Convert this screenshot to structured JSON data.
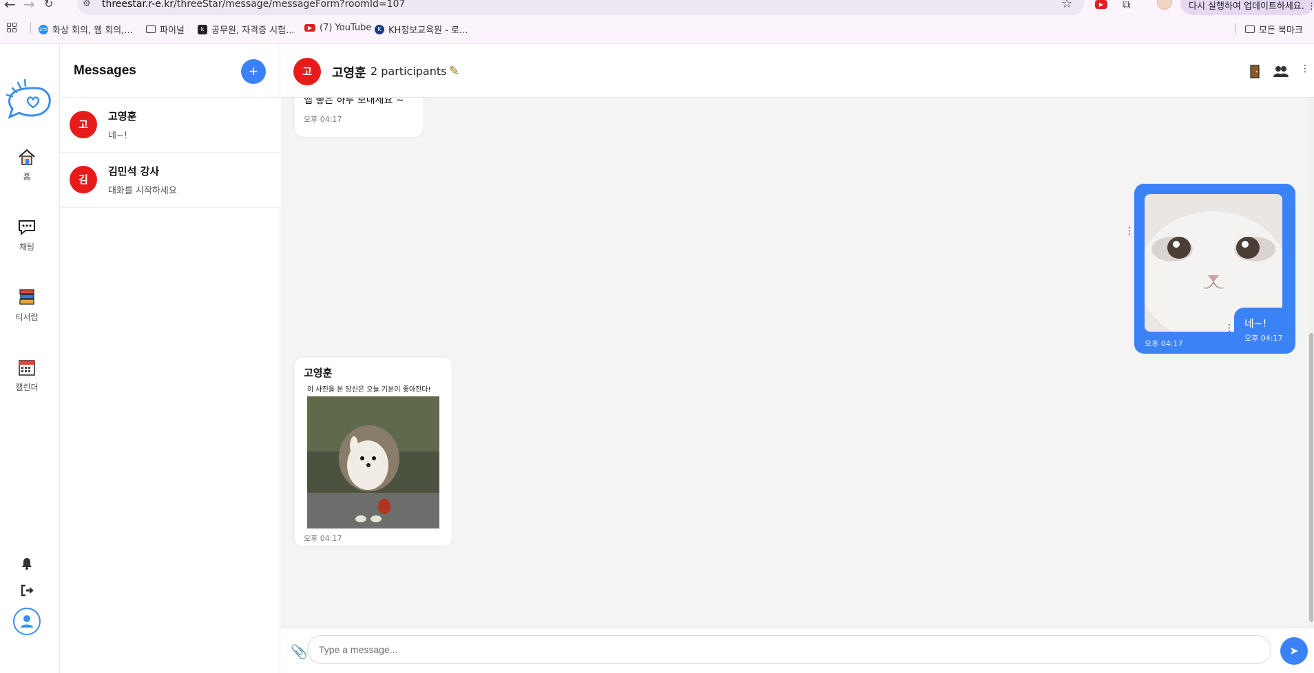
{
  "browser": {
    "url_host": "threestar.r-e.kr",
    "url_path": "/threeStar/message/messageForm?roomId=107",
    "update_label": "다시 실행하여 업데이트하세요.",
    "bookmarks": [
      {
        "label": "화상 회의, 웹 회의,...",
        "icon": "zoom-icon",
        "color": "#2d8cff"
      },
      {
        "label": "파이널",
        "icon": "folder-icon"
      },
      {
        "label": "공무원, 자격증 시험...",
        "icon": "kdata-icon",
        "color": "#222222"
      },
      {
        "label": "(7) YouTube",
        "icon": "youtube-icon",
        "color": "#e02020"
      },
      {
        "label": "KH정보교육원 - 로...",
        "icon": "kh-icon",
        "color": "#1e3a8a"
      }
    ],
    "all_bookmarks": "모든 북마크"
  },
  "rail": {
    "items": [
      {
        "label": "홈",
        "icon": "home-icon"
      },
      {
        "label": "채팅",
        "icon": "chat-icon"
      },
      {
        "label": "티서랍",
        "icon": "books-icon"
      },
      {
        "label": "캘린더",
        "icon": "calendar-icon"
      }
    ]
  },
  "list": {
    "title": "Messages",
    "add": "+",
    "rooms": [
      {
        "avatar": "고",
        "name": "고영훈",
        "last": "네~!"
      },
      {
        "avatar": "김",
        "name": "김민석 강사",
        "last": "대화를 시작하세요"
      }
    ]
  },
  "chat": {
    "avatar": "고",
    "name": "고영훈",
    "participants": "2 participants",
    "messages": {
      "m1": {
        "text": "맵 좋은 하루 보내세요 ~",
        "time": "오후 04:17"
      },
      "m2": {
        "time": "오후 04:17",
        "image": "white kitten photo"
      },
      "m3": {
        "text": "네~!",
        "time": "오후 04:17"
      },
      "m4": {
        "sender": "고영훈",
        "caption": "이 사진을 본 당신은 오늘 기분이 좋아진다!",
        "time": "오후 04:17",
        "image": "hedgehog photo"
      }
    },
    "input_placeholder": "Type a message..."
  },
  "colors": {
    "accent": "#3b82f6",
    "avatar": "#e81b1b",
    "chat_bg": "#f4f4f2"
  }
}
